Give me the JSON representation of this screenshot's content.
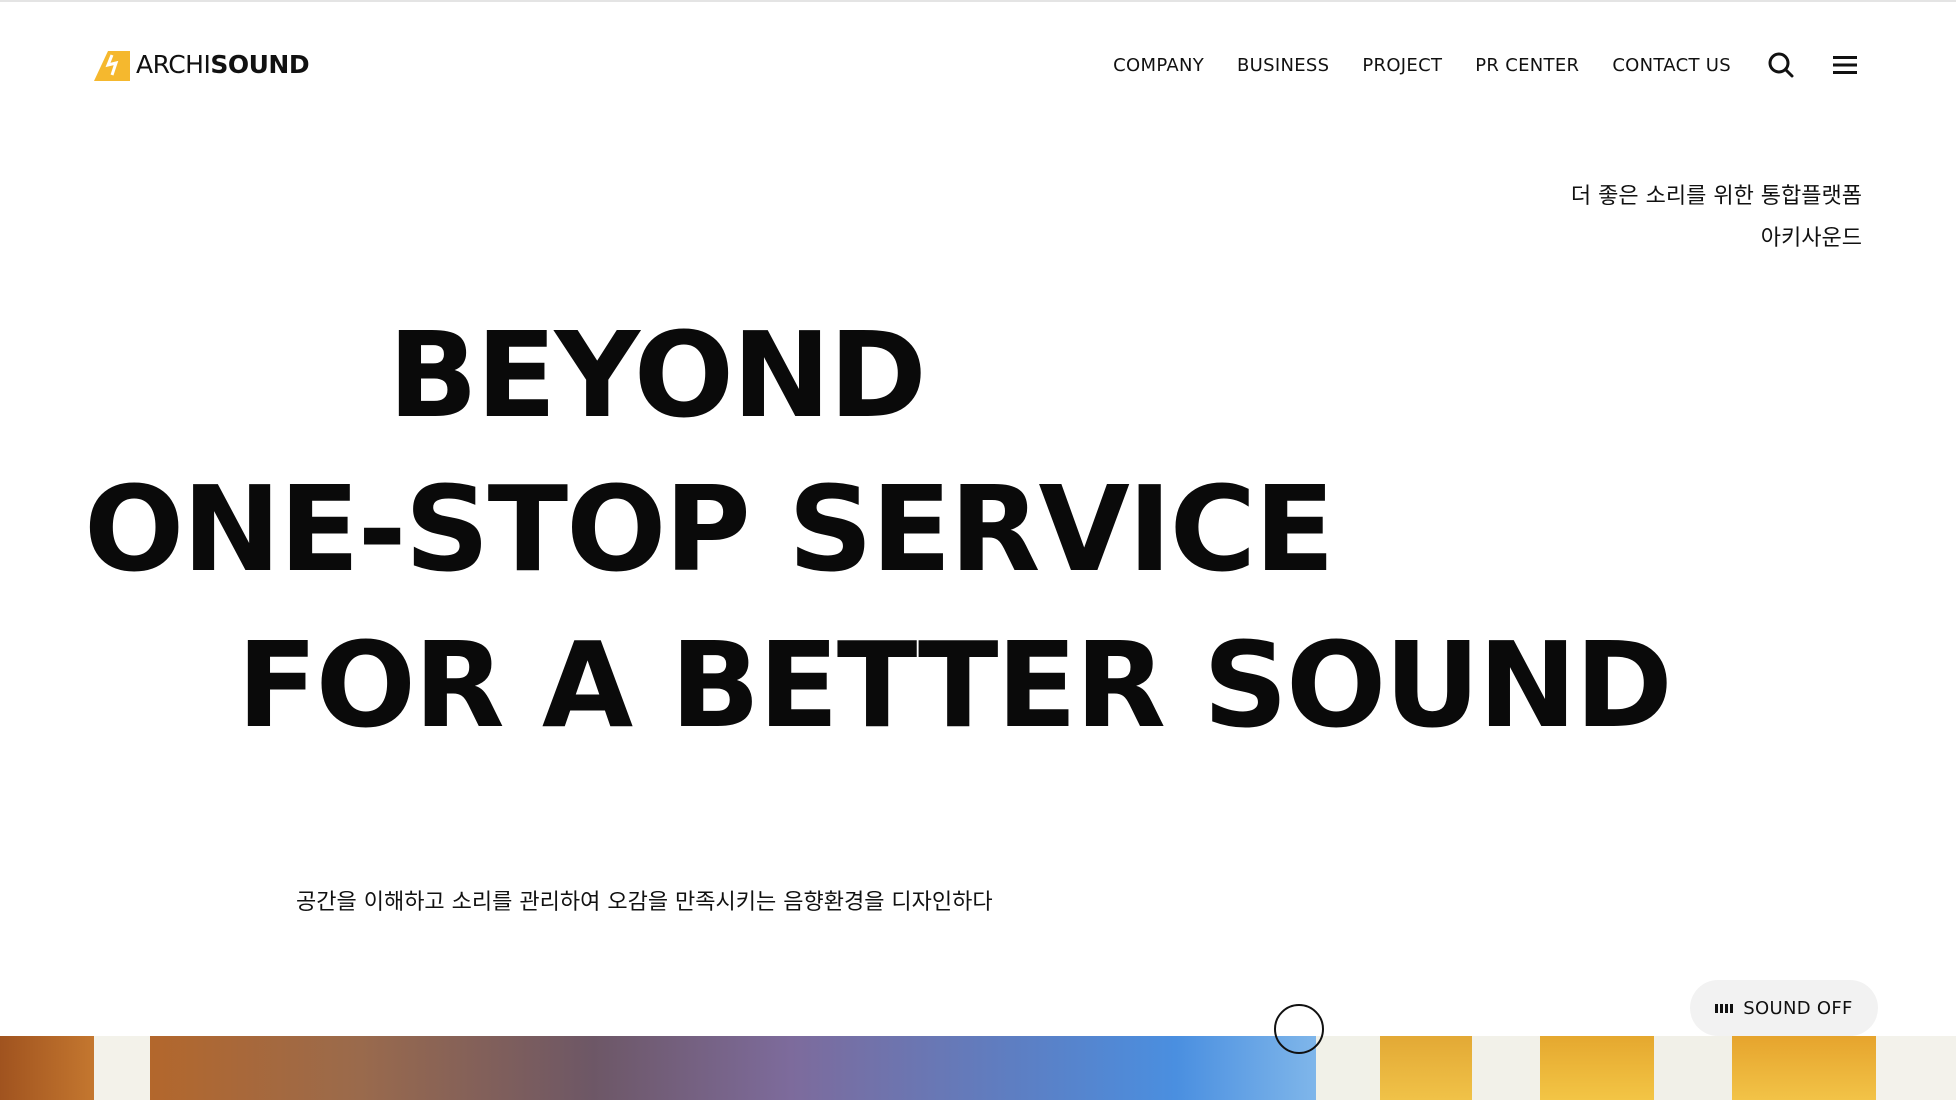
{
  "brand": {
    "name_light": "ARCHI",
    "name_bold": "SOUND",
    "accent_color": "#f5b82e"
  },
  "nav": {
    "items": [
      {
        "label": "COMPANY"
      },
      {
        "label": "BUSINESS"
      },
      {
        "label": "PROJECT"
      },
      {
        "label": "PR CENTER"
      },
      {
        "label": "CONTACT US"
      }
    ],
    "search_icon": "search-icon",
    "menu_icon": "hamburger-menu-icon"
  },
  "hero": {
    "tagline_line1": "더 좋은 소리를 위한 통합플랫폼",
    "tagline_line2": "아키사운드",
    "headline_line1": "BEYOND",
    "headline_line2": "ONE-STOP SERVICE",
    "headline_line3": "FOR A BETTER SOUND",
    "subline": "공간을 이해하고 소리를 관리하여 오감을 만족시키는 음향환경을 디자인하다"
  },
  "sound_toggle": {
    "label": "SOUND OFF",
    "icon": "sound-bars-icon"
  }
}
